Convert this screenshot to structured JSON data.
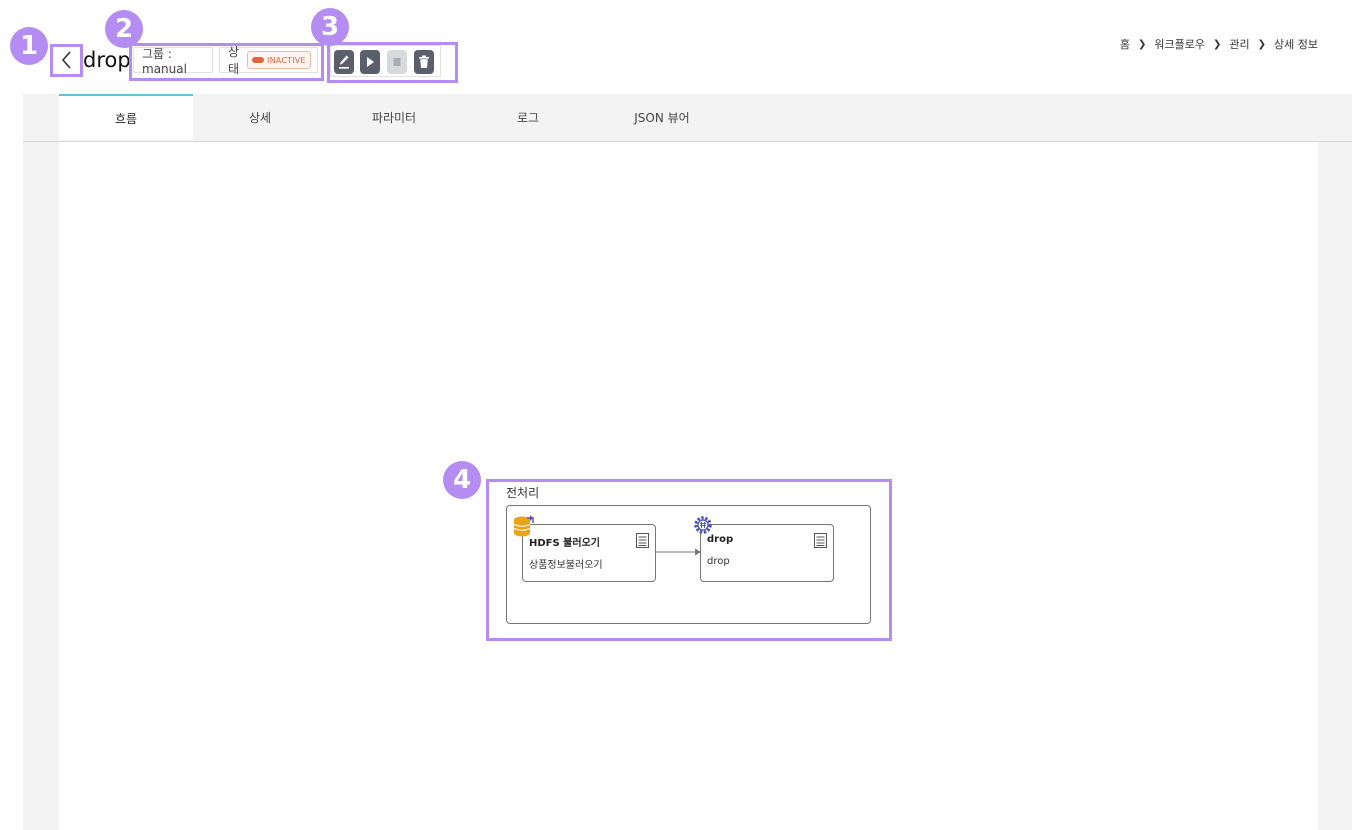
{
  "header": {
    "title": "drop",
    "group_text": "그룹 : manual",
    "status_label": "상태",
    "status_value": "INACTIVE"
  },
  "toolbar": {
    "buttons": [
      {
        "name": "edit",
        "icon": "pencil-icon",
        "enabled": true
      },
      {
        "name": "run",
        "icon": "play-icon",
        "enabled": true
      },
      {
        "name": "stop",
        "icon": "stop-icon",
        "enabled": false
      },
      {
        "name": "delete",
        "icon": "trash-icon",
        "enabled": true
      }
    ]
  },
  "breadcrumb": [
    "홈",
    "워크플로우",
    "관리",
    "상세 정보"
  ],
  "tabs": [
    {
      "label": "흐름",
      "active": true
    },
    {
      "label": "상세",
      "active": false
    },
    {
      "label": "파라미터",
      "active": false
    },
    {
      "label": "로그",
      "active": false
    },
    {
      "label": "JSON 뷰어",
      "active": false
    }
  ],
  "flow": {
    "group_label": "전처리",
    "nodes": [
      {
        "title": "HDFS 불러오기",
        "subtitle": "상품정보불러오기",
        "icon": "database-icon"
      },
      {
        "title": "drop",
        "subtitle": "drop",
        "icon": "gear-icon"
      }
    ]
  },
  "callouts": [
    "1",
    "2",
    "3",
    "4"
  ],
  "colors": {
    "callout": "#b48cf2",
    "tab_active_accent": "#5bc6d8",
    "status_inactive": "#e0653c",
    "database_icon": "#e8a317",
    "gear_icon": "#4b4fb3"
  }
}
